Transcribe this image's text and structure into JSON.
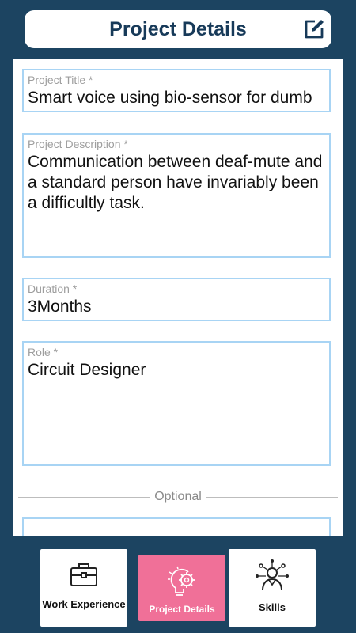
{
  "header": {
    "title": "Project Details",
    "edit_icon": "edit-icon"
  },
  "form": {
    "project_title": {
      "label": "Project Title *",
      "value": "Smart voice using bio-sensor for dumb"
    },
    "project_description": {
      "label": "Project Description *",
      "value": "Communication between deaf-mute and a standard person have invariably been a difficultly task."
    },
    "duration": {
      "label": "Duration *",
      "value": "3Months"
    },
    "role": {
      "label": "Role *",
      "value": "Circuit Designer"
    },
    "optional_label": "Optional"
  },
  "bottom_nav": {
    "items": [
      {
        "label": "Work Experience",
        "icon": "briefcase-icon",
        "active": false
      },
      {
        "label": "Project Details",
        "icon": "lightbulb-gear-icon",
        "active": true
      },
      {
        "label": "Skills",
        "icon": "person-network-icon",
        "active": false
      }
    ]
  },
  "colors": {
    "background": "#1c4461",
    "title_text": "#173a59",
    "field_border": "#a8d4f4",
    "active_tab": "#f07098"
  }
}
